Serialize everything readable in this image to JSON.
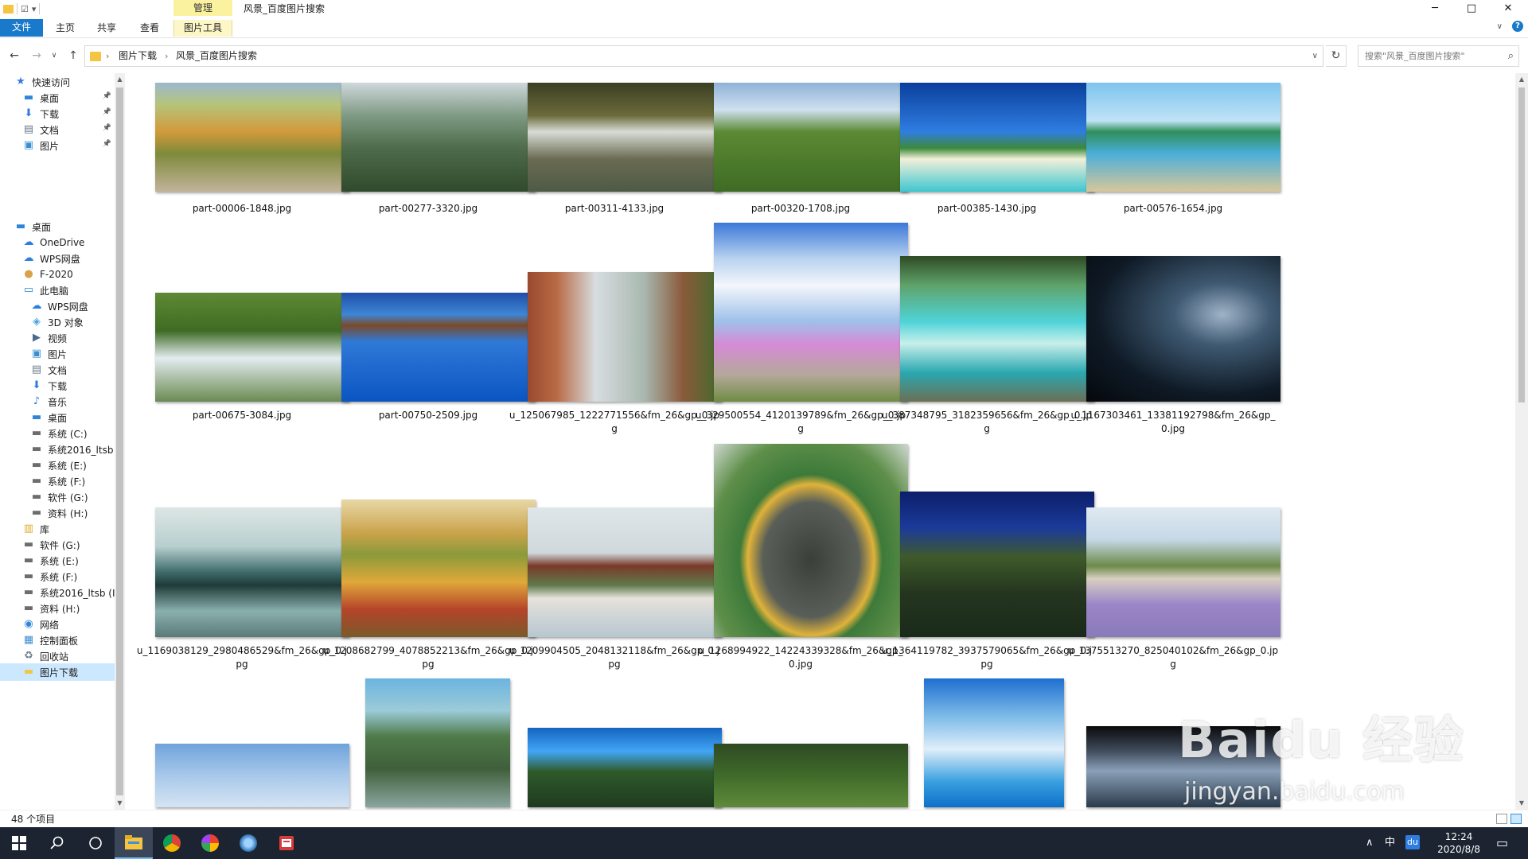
{
  "window": {
    "title": "风景_百度图片搜索",
    "context_tab": "管理",
    "controls": {
      "minimize": "─",
      "maximize": "□",
      "close": "✕"
    }
  },
  "ribbon": {
    "tabs": [
      "文件",
      "主页",
      "共享",
      "查看",
      "图片工具"
    ]
  },
  "navigation": {
    "breadcrumb": [
      "图片下载",
      "风景_百度图片搜索"
    ],
    "search_placeholder": "搜索\"风景_百度图片搜索\""
  },
  "nav_pane": {
    "items": [
      {
        "label": "快速访问",
        "icon": "star-icon",
        "level": 0,
        "pinned": false,
        "selected": false
      },
      {
        "label": "桌面",
        "icon": "desktop-icon",
        "level": 1,
        "pinned": true,
        "selected": false
      },
      {
        "label": "下载",
        "icon": "download-icon",
        "level": 1,
        "pinned": true,
        "selected": false
      },
      {
        "label": "文档",
        "icon": "document-icon",
        "level": 1,
        "pinned": true,
        "selected": false
      },
      {
        "label": "图片",
        "icon": "picture-icon",
        "level": 1,
        "pinned": true,
        "selected": false
      },
      {
        "label": "桌面",
        "icon": "desktop-icon",
        "level": 0,
        "pinned": false,
        "selected": false
      },
      {
        "label": "OneDrive",
        "icon": "cloud-icon",
        "level": 1,
        "pinned": false,
        "selected": false
      },
      {
        "label": "WPS网盘",
        "icon": "cloud-outline-icon",
        "level": 1,
        "pinned": false,
        "selected": false
      },
      {
        "label": "F-2020",
        "icon": "user-icon",
        "level": 1,
        "pinned": false,
        "selected": false
      },
      {
        "label": "此电脑",
        "icon": "computer-icon",
        "level": 1,
        "pinned": false,
        "selected": false
      },
      {
        "label": "WPS网盘",
        "icon": "cloud-outline-icon",
        "level": 2,
        "pinned": false,
        "selected": false
      },
      {
        "label": "3D 对象",
        "icon": "cube-icon",
        "level": 2,
        "pinned": false,
        "selected": false
      },
      {
        "label": "视频",
        "icon": "video-icon",
        "level": 2,
        "pinned": false,
        "selected": false
      },
      {
        "label": "图片",
        "icon": "picture-icon",
        "level": 2,
        "pinned": false,
        "selected": false
      },
      {
        "label": "文档",
        "icon": "document-icon",
        "level": 2,
        "pinned": false,
        "selected": false
      },
      {
        "label": "下载",
        "icon": "download-icon",
        "level": 2,
        "pinned": false,
        "selected": false
      },
      {
        "label": "音乐",
        "icon": "music-icon",
        "level": 2,
        "pinned": false,
        "selected": false
      },
      {
        "label": "桌面",
        "icon": "desktop-icon",
        "level": 2,
        "pinned": false,
        "selected": false
      },
      {
        "label": "系统 (C:)",
        "icon": "drive-icon",
        "level": 2,
        "pinned": false,
        "selected": false
      },
      {
        "label": "系统2016_ltsb",
        "icon": "drive-icon",
        "level": 2,
        "pinned": false,
        "selected": false
      },
      {
        "label": "系统 (E:)",
        "icon": "drive-icon",
        "level": 2,
        "pinned": false,
        "selected": false
      },
      {
        "label": "系统 (F:)",
        "icon": "drive-icon",
        "level": 2,
        "pinned": false,
        "selected": false
      },
      {
        "label": "软件 (G:)",
        "icon": "drive-icon",
        "level": 2,
        "pinned": false,
        "selected": false
      },
      {
        "label": "资料 (H:)",
        "icon": "drive-icon",
        "level": 2,
        "pinned": false,
        "selected": false
      },
      {
        "label": "库",
        "icon": "library-icon",
        "level": 1,
        "pinned": false,
        "selected": false
      },
      {
        "label": "软件 (G:)",
        "icon": "drive-icon",
        "level": 1,
        "pinned": false,
        "selected": false
      },
      {
        "label": "系统 (E:)",
        "icon": "drive-icon",
        "level": 1,
        "pinned": false,
        "selected": false
      },
      {
        "label": "系统 (F:)",
        "icon": "drive-icon",
        "level": 1,
        "pinned": false,
        "selected": false
      },
      {
        "label": "系统2016_ltsb (I",
        "icon": "drive-icon",
        "level": 1,
        "pinned": false,
        "selected": false
      },
      {
        "label": "资料 (H:)",
        "icon": "drive-icon",
        "level": 1,
        "pinned": false,
        "selected": false
      },
      {
        "label": "网络",
        "icon": "network-icon",
        "level": 1,
        "pinned": false,
        "selected": false
      },
      {
        "label": "控制面板",
        "icon": "control-panel-icon",
        "level": 1,
        "pinned": false,
        "selected": false
      },
      {
        "label": "回收站",
        "icon": "recycle-bin-icon",
        "level": 1,
        "pinned": false,
        "selected": false
      },
      {
        "label": "图片下载",
        "icon": "folder-icon",
        "level": 1,
        "pinned": false,
        "selected": true
      }
    ]
  },
  "files": [
    {
      "name": "part-00006-1848.jpg",
      "scene": "autumn-mountain-bridge"
    },
    {
      "name": "part-00277-3320.jpg",
      "scene": "karst-pillars"
    },
    {
      "name": "part-00311-4133.jpg",
      "scene": "waterfall-pool"
    },
    {
      "name": "part-00320-1708.jpg",
      "scene": "green-valley"
    },
    {
      "name": "part-00385-1430.jpg",
      "scene": "tropical-beach"
    },
    {
      "name": "part-00576-1654.jpg",
      "scene": "clear-sea-shore"
    },
    {
      "name": "part-00675-3084.jpg",
      "scene": "forest-cascade"
    },
    {
      "name": "part-00750-2509.jpg",
      "scene": "water-villas"
    },
    {
      "name": "u_125067985_1222771556&fm_26&gp_0.jpg",
      "scene": "red-cliff-mist"
    },
    {
      "name": "u_329500554_4120139789&fm_26&gp_0.jpg",
      "scene": "flower-field-road"
    },
    {
      "name": "u_387348795_3182359656&fm_26&gp_0.jpg",
      "scene": "turquoise-terraces"
    },
    {
      "name": "u_1167303461_13381192798&fm_26&gp_0.jpg",
      "scene": "night-fantasy"
    },
    {
      "name": "u_1169038129_2980486529&fm_26&gp_0.jpg",
      "scene": "misty-lake"
    },
    {
      "name": "u_1208682799_4078852213&fm_26&gp_0.jpg",
      "scene": "painted-village"
    },
    {
      "name": "u_1209904505_2048132118&fm_26&gp_0.jpg",
      "scene": "pavilion-lake"
    },
    {
      "name": "u_1268994922_14224339328&fm_26&gp_0.jpg",
      "scene": "crater-lake"
    },
    {
      "name": "u_1364119782_3937579065&fm_26&gp_0.jpg",
      "scene": "moon-village"
    },
    {
      "name": "u_1375513270_825040102&fm_26&gp_0.jpg",
      "scene": "lavender-village"
    },
    {
      "name": "",
      "scene": "sky-partial"
    },
    {
      "name": "",
      "scene": "painted-peak-bridge"
    },
    {
      "name": "",
      "scene": "palm-mountain"
    },
    {
      "name": "",
      "scene": "green-hills"
    },
    {
      "name": "",
      "scene": "seagulls-island"
    },
    {
      "name": "",
      "scene": "dark-lake-houses"
    }
  ],
  "status": {
    "item_count": "48 个项目"
  },
  "taskbar": {
    "apps": [
      {
        "name": "file-explorer",
        "active": true
      },
      {
        "name": "chrome",
        "active": false
      },
      {
        "name": "chrome-alt",
        "active": false
      },
      {
        "name": "app-tool",
        "active": false
      },
      {
        "name": "wps",
        "active": false
      }
    ],
    "ime": "中",
    "ime_du": "du",
    "time": "12:24",
    "date": "2020/8/8"
  },
  "watermark": {
    "brand": "Baidu 经验",
    "url": "jingyan.baidu.com"
  }
}
